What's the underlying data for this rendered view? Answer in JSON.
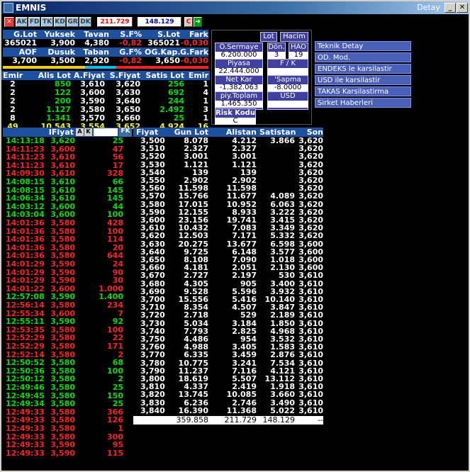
{
  "window": {
    "title": "EMNIS",
    "right_title": "Detay"
  },
  "toolbar": {
    "tabs": [
      "AK",
      "FD",
      "TK",
      "KD",
      "GR",
      "DK"
    ],
    "value1": "211.729",
    "value2": "148.129",
    "c_label": "C"
  },
  "summary": {
    "row1_headers": [
      "G.Lot",
      "Yuksek",
      "Tavan",
      "S.F%",
      "S.Lot",
      "Fark"
    ],
    "row1_values": [
      "365021",
      "3,900",
      "4,380",
      "-0,82",
      "365021",
      "-0,030"
    ],
    "row2_headers": [
      "AOF",
      "Dusuk",
      "Taban",
      "G.F%",
      "OG.Kap.",
      "G.Fark"
    ],
    "row2_values": [
      "3,700",
      "3,500",
      "2,920",
      "-0,82",
      "3,650",
      "-0,030"
    ]
  },
  "panel": {
    "lot": "Lot",
    "hacim": "Hacim",
    "o_sermaye_label": "Ö.Sermaye",
    "o_sermaye": "6.200.000",
    "don_label": "Dön.",
    "don": "3",
    "hao_label": "HAO",
    "hao": "19",
    "piyasa_label": "Piyasa Değeri",
    "piyasa": "22.444.000",
    "fk_label": "F / K",
    "fk": "",
    "net_kar_label": "Net Kar",
    "net_kar": "-1.382.063",
    "sapma_label": "'Sapma",
    "sapma": "-8.0000",
    "piy_toplam_label": "piy.Toplam Lot",
    "piy_toplam": "1.465.350",
    "usd_label": "USD Değeri",
    "usd": "",
    "risk_label": "Risk Kodu",
    "risk": "C"
  },
  "menu": [
    "Teknik Detay",
    "OD. Mod.",
    "ENDEKS le karsilastir",
    "USD ile karsilastir",
    "TAKAS Karsilastirma",
    "Sirket Haberleri"
  ],
  "orders": {
    "headers": [
      "Emir",
      "Alis Lot",
      "A.Fiyat",
      "S.Fiyat",
      "Satis Lot",
      "Emir"
    ],
    "rows": [
      [
        "2",
        "850",
        "3,610",
        "3,620",
        "256",
        "1"
      ],
      [
        "2",
        "122",
        "3,600",
        "3,630",
        "692",
        "4"
      ],
      [
        "2",
        "200",
        "3,590",
        "3,640",
        "244",
        "1"
      ],
      [
        "2",
        "1.127",
        "3,580",
        "3,650",
        "2.492",
        "3"
      ],
      [
        "8",
        "1.341",
        "3,570",
        "3,660",
        "25",
        "1"
      ]
    ],
    "totals": [
      "49",
      "10.543",
      "3,554",
      "3,652",
      "4.924",
      "16"
    ]
  },
  "trades": {
    "header": "IFiyat",
    "a_btn": "A",
    "k_btn": "K",
    "fk_btn": "FK",
    "rows": [
      [
        "14:13:18",
        "3,620",
        "25",
        "g"
      ],
      [
        "14:11:23",
        "3,600",
        "47",
        "r"
      ],
      [
        "14:11:23",
        "3,610",
        "56",
        "r"
      ],
      [
        "14:11:23",
        "3,610",
        "17",
        "r"
      ],
      [
        "14:09:30",
        "3,610",
        "328",
        "r"
      ],
      [
        "14:08:15",
        "3,610",
        "66",
        "g"
      ],
      [
        "14:08:15",
        "3,610",
        "145",
        "g"
      ],
      [
        "14:06:34",
        "3,610",
        "145",
        "g"
      ],
      [
        "14:03:12",
        "3,600",
        "44",
        "g"
      ],
      [
        "14:03:04",
        "3,600",
        "100",
        "g"
      ],
      [
        "14:01:36",
        "3,580",
        "428",
        "r"
      ],
      [
        "14:01:36",
        "3,580",
        "100",
        "r"
      ],
      [
        "14:01:36",
        "3,580",
        "114",
        "r"
      ],
      [
        "14:01:36",
        "3,580",
        "20",
        "r"
      ],
      [
        "14:01:36",
        "3,580",
        "644",
        "r"
      ],
      [
        "14:01:29",
        "3,590",
        "24",
        "r"
      ],
      [
        "14:01:29",
        "3,590",
        "90",
        "r"
      ],
      [
        "14:01:29",
        "3,590",
        "30",
        "r"
      ],
      [
        "14:01:22",
        "3,600",
        "1.000",
        "r"
      ],
      [
        "12:57:08",
        "3,590",
        "1.400",
        "g"
      ],
      [
        "12:56:14",
        "3,580",
        "234",
        "r"
      ],
      [
        "12:55:34",
        "3,600",
        "7",
        "r"
      ],
      [
        "12:55:11",
        "3,590",
        "92",
        "g"
      ],
      [
        "12:53:35",
        "3,580",
        "100",
        "r"
      ],
      [
        "12:52:29",
        "3,580",
        "22",
        "r"
      ],
      [
        "12:52:29",
        "3,580",
        "171",
        "r"
      ],
      [
        "12:52:14",
        "3,580",
        "2",
        "r"
      ],
      [
        "12:50:52",
        "3,580",
        "68",
        "g"
      ],
      [
        "12:50:36",
        "3,580",
        "100",
        "g"
      ],
      [
        "12:50:12",
        "3,580",
        "2",
        "g"
      ],
      [
        "12:49:46",
        "3,580",
        "25",
        "g"
      ],
      [
        "12:49:45",
        "3,580",
        "150",
        "g"
      ],
      [
        "12:49:34",
        "3,580",
        "25",
        "g"
      ],
      [
        "12:49:33",
        "3,580",
        "366",
        "r"
      ],
      [
        "12:49:33",
        "3,580",
        "126",
        "r"
      ],
      [
        "12:49:33",
        "3,580",
        "1",
        "r"
      ],
      [
        "12:49:33",
        "3,580",
        "300",
        "r"
      ],
      [
        "12:49:33",
        "3,590",
        "95",
        "r"
      ],
      [
        "12:49:33",
        "3,590",
        "115",
        "r"
      ]
    ]
  },
  "depth": {
    "headers": [
      "Fiyat",
      "Gun Lot",
      "Alistan",
      "Satistan",
      "Son"
    ],
    "rows": [
      [
        "3,500",
        "8.078",
        "4.212",
        "3.866",
        "3,620"
      ],
      [
        "3,510",
        "2.327",
        "2.327",
        "",
        "3,620"
      ],
      [
        "3,520",
        "3.001",
        "3.001",
        "",
        "3,620"
      ],
      [
        "3,530",
        "1.121",
        "1.121",
        "",
        "3,620"
      ],
      [
        "3,540",
        "139",
        "139",
        "",
        "3,620"
      ],
      [
        "3,550",
        "2.902",
        "2.902",
        "",
        "3,620"
      ],
      [
        "3,560",
        "11.598",
        "11.598",
        "",
        "3,620"
      ],
      [
        "3,570",
        "15.766",
        "11.677",
        "4.089",
        "3,620"
      ],
      [
        "3,580",
        "17.015",
        "10.952",
        "6.063",
        "3,620"
      ],
      [
        "3,590",
        "12.155",
        "8.933",
        "3.222",
        "3,620"
      ],
      [
        "3,600",
        "23.156",
        "19.741",
        "3.415",
        "3,620"
      ],
      [
        "3,610",
        "10.432",
        "7.083",
        "3.349",
        "3,620"
      ],
      [
        "3,620",
        "12.503",
        "7.171",
        "5.332",
        "3,620"
      ],
      [
        "3,630",
        "20.275",
        "13.677",
        "6.598",
        "3,600"
      ],
      [
        "3,640",
        "9.725",
        "6.148",
        "3.577",
        "3,600"
      ],
      [
        "3,650",
        "8.108",
        "7.090",
        "1.018",
        "3,600"
      ],
      [
        "3,660",
        "4.181",
        "2.051",
        "2.130",
        "3,600"
      ],
      [
        "3,670",
        "2.727",
        "2.197",
        "530",
        "3,610"
      ],
      [
        "3,680",
        "4.305",
        "905",
        "3.400",
        "3,610"
      ],
      [
        "3,690",
        "9.528",
        "5.596",
        "3.932",
        "3,610"
      ],
      [
        "3,700",
        "15.556",
        "5.416",
        "10.140",
        "3,610"
      ],
      [
        "3,710",
        "8.354",
        "4.507",
        "3.847",
        "3,610"
      ],
      [
        "3,720",
        "2.718",
        "529",
        "2.189",
        "3,610"
      ],
      [
        "3,730",
        "5.034",
        "3.184",
        "1.850",
        "3,610"
      ],
      [
        "3,740",
        "7.793",
        "2.825",
        "4.968",
        "3,610"
      ],
      [
        "3,750",
        "4.486",
        "954",
        "3.532",
        "3,610"
      ],
      [
        "3,760",
        "4.988",
        "3.405",
        "1.583",
        "3,610"
      ],
      [
        "3,770",
        "6.335",
        "3.459",
        "2.876",
        "3,610"
      ],
      [
        "3,780",
        "10.775",
        "3.241",
        "7.534",
        "3,610"
      ],
      [
        "3,790",
        "11.237",
        "7.116",
        "4.121",
        "3,610"
      ],
      [
        "3,800",
        "18.619",
        "5.507",
        "13.112",
        "3,610"
      ],
      [
        "3,810",
        "4.337",
        "2.419",
        "1.918",
        "3,610"
      ],
      [
        "3,820",
        "13.745",
        "10.085",
        "3.660",
        "3,610"
      ],
      [
        "3,830",
        "6.236",
        "2.746",
        "3.490",
        "3,610"
      ],
      [
        "3,840",
        "16.390",
        "11.368",
        "5.022",
        "3,610"
      ]
    ],
    "totals": [
      "",
      "359.858",
      "211.729",
      "148.129",
      "--"
    ]
  }
}
